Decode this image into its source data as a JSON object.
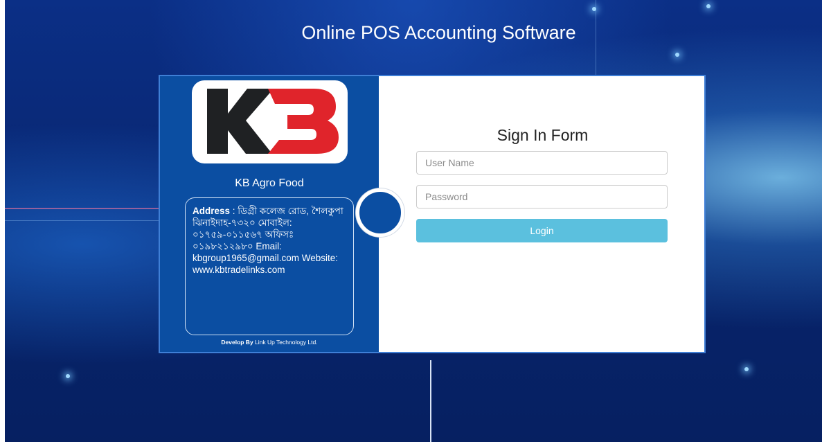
{
  "page": {
    "title": "Online POS Accounting Software"
  },
  "company": {
    "logo_text": "KB",
    "name": "KB Agro Food",
    "address_label": "Address",
    "address_text": " : ডিগ্রী কলেজ রোড, শৈলকুপা ঝিনাইদাহ-৭৩২০ মোবাইল: ০১৭৫৯-০১১৫৬৭ অফিসঃ ০১৯৮২১২৯৮০ Email: kbgroup1965@gmail.com Website: www.kbtradelinks.com",
    "developed_by_label": "Develop By",
    "developer": " Link Up Technology Ltd."
  },
  "form": {
    "title": "Sign In Form",
    "username_placeholder": "User Name",
    "username_value": "",
    "password_placeholder": "Password",
    "password_value": "",
    "login_label": "Login"
  },
  "colors": {
    "panel_blue": "#0b4ea2",
    "login_button": "#5bc0de",
    "logo_red": "#e0242b",
    "logo_dark": "#1f2123"
  }
}
